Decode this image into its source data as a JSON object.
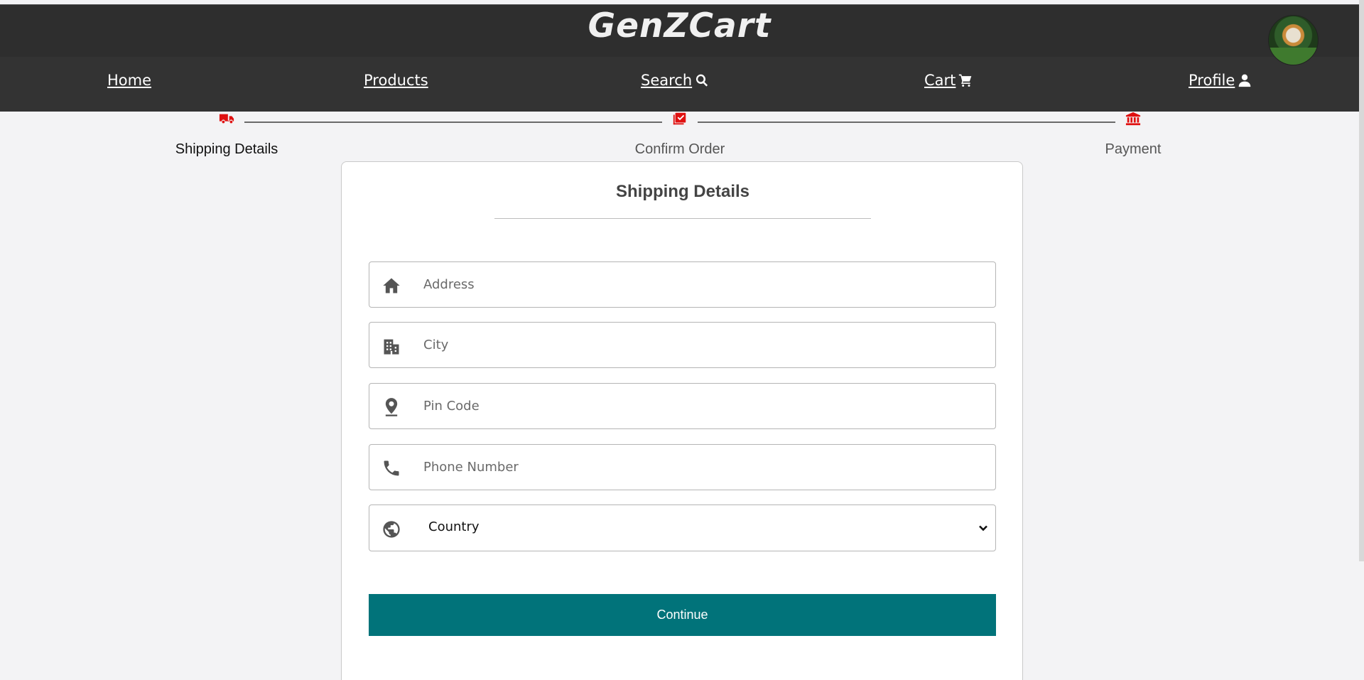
{
  "header": {
    "brand": "GenZCart",
    "nav": [
      {
        "label": "Home",
        "icon": null
      },
      {
        "label": "Products",
        "icon": null
      },
      {
        "label": "Search",
        "icon": "search-icon"
      },
      {
        "label": "Cart",
        "icon": "cart-icon"
      },
      {
        "label": "Profile",
        "icon": "user-icon"
      }
    ],
    "avatar": "user-avatar"
  },
  "stepper": {
    "steps": [
      {
        "label": "Shipping Details",
        "icon": "truck-icon",
        "active": true
      },
      {
        "label": "Confirm Order",
        "icon": "checklist-icon",
        "active": false
      },
      {
        "label": "Payment",
        "icon": "bank-icon",
        "active": false
      }
    ],
    "accent_color": "#e01010"
  },
  "form": {
    "title": "Shipping Details",
    "fields": [
      {
        "placeholder": "Address",
        "value": "",
        "icon": "home-icon"
      },
      {
        "placeholder": "City",
        "value": "",
        "icon": "city-icon"
      },
      {
        "placeholder": "Pin Code",
        "value": "",
        "icon": "location-pin-icon"
      },
      {
        "placeholder": "Phone Number",
        "value": "",
        "icon": "phone-icon"
      }
    ],
    "country_select": {
      "selected": "Country",
      "icon": "globe-icon"
    },
    "continue_label": "Continue",
    "button_color": "#01737a"
  }
}
